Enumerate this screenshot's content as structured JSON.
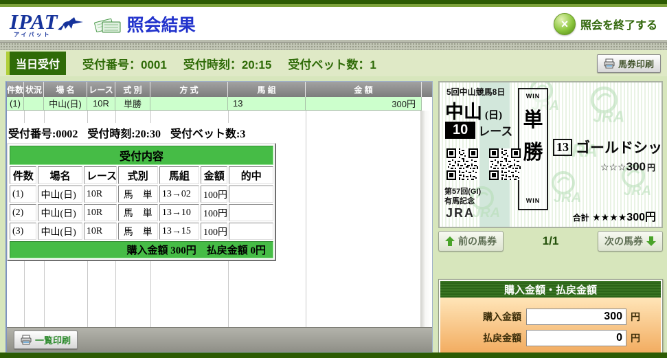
{
  "header": {
    "logo_text": "IPAT",
    "logo_sub": "アイパット",
    "title": "照会結果",
    "close_label": "照会を終了する",
    "close_icon_glyph": "×"
  },
  "receipt_bar": {
    "badge": "当日受付",
    "number_label": "受付番号：0001",
    "time_label": "受付時刻：20:15",
    "bets_label": "受付ベット数：1",
    "print_label": "馬券印刷"
  },
  "main_table": {
    "headers": [
      "件数",
      "状況",
      "場 名",
      "レース",
      "式 別",
      "方 式",
      "馬 組",
      "金 額"
    ],
    "rows": [
      {
        "cells": [
          "(1)",
          "",
          "中山(日)",
          "10R",
          "単勝",
          "",
          "13",
          "300円"
        ]
      }
    ]
  },
  "popup": {
    "title_number": "受付番号:0002",
    "title_time": "受付時刻:20:30",
    "title_bets": "受付ベット数:3",
    "header": "受付内容",
    "col_headers": [
      "件数",
      "場名",
      "レース",
      "式別",
      "馬組",
      "金額",
      "的中"
    ],
    "rows": [
      [
        "(1)",
        "中山(日)",
        "10R",
        "馬　単",
        "13→02",
        "100円",
        ""
      ],
      [
        "(2)",
        "中山(日)",
        "10R",
        "馬　単",
        "13→10",
        "100円",
        ""
      ],
      [
        "(3)",
        "中山(日)",
        "10R",
        "馬　単",
        "13→15",
        "100円",
        ""
      ]
    ],
    "footer": "購入金額 300円　払戻金額 0円"
  },
  "bottom_bar": {
    "list_print_label": "一覧印刷"
  },
  "ticket": {
    "meeting": "5回中山競馬8日",
    "course": "中山",
    "day": "(日)",
    "race_no": "10",
    "race_suffix": "レース",
    "bet_type_top": "WIN",
    "bet_char1": "単",
    "bet_char2": "勝",
    "bet_type_bottom": "WIN",
    "horse_no": "13",
    "horse_name": "ゴールドシップ",
    "stake_stars": "☆☆☆",
    "stake_amount": "300",
    "stake_unit": "円",
    "race_title1": "第57回(GI)",
    "race_title2": "有馬記念",
    "org": "JRA",
    "total_label": "合計",
    "total_stars": "★★★★",
    "total_amount": "300円"
  },
  "ticket_nav": {
    "prev_label": "前の馬券",
    "page": "1/1",
    "next_label": "次の馬券"
  },
  "money_panel": {
    "title": "購入金額・払戻金額",
    "rows": [
      {
        "label": "購入金額",
        "value": "300",
        "unit": "円"
      },
      {
        "label": "払戻金額",
        "value": "0",
        "unit": "円"
      }
    ]
  },
  "colors": {
    "accent_dark_green": "#2c5b03",
    "bar_green": "#dfe9c6",
    "row_green": "#ccffcc",
    "popup_green": "#46bc46",
    "money_orange": "#f1a758"
  }
}
